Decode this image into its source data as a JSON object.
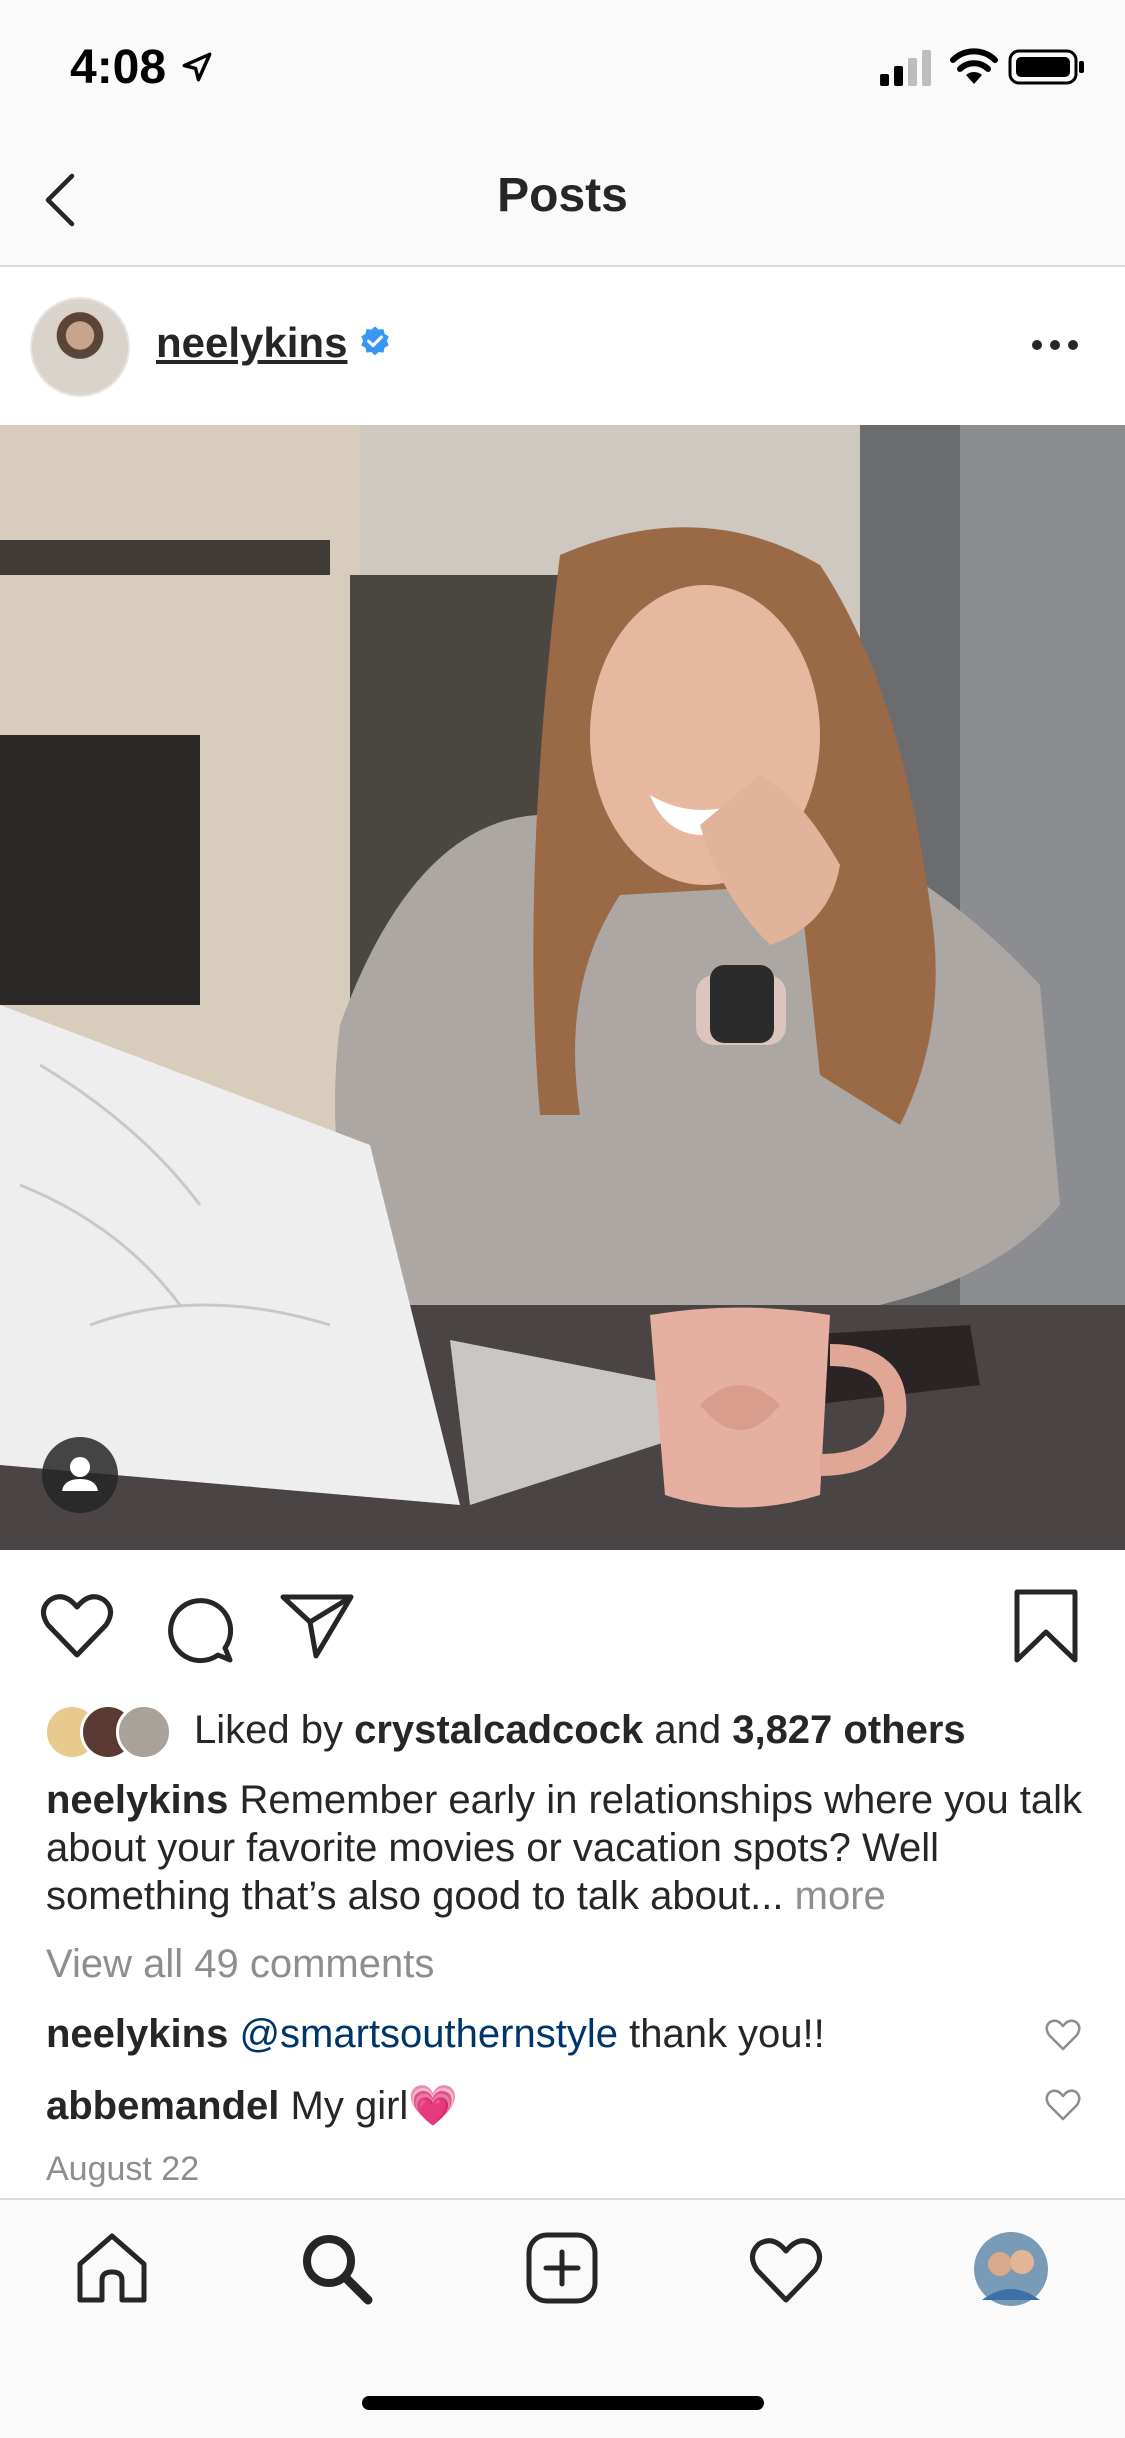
{
  "status_bar": {
    "time": "4:08"
  },
  "header": {
    "title": "Posts"
  },
  "post": {
    "username": "neelykins",
    "likes": {
      "prefix": "Liked by",
      "user": "crystalcadcock",
      "and": "and",
      "count": "3,827 others"
    },
    "caption": {
      "user": "neelykins",
      "text": "Remember early in relationships where you talk about your favorite movies or vacation spots? Well something that’s also good to talk about...",
      "more": "more"
    },
    "view_all_comments": "View all 49 comments",
    "comments": [
      {
        "user": "neelykins",
        "mention": "@smartsouthernstyle",
        "text": "thank you!!"
      },
      {
        "user": "abbemandel",
        "text": "My girl💗"
      }
    ],
    "date": "August 22"
  },
  "tabs": [
    "home-icon",
    "search-icon",
    "new-post-icon",
    "activity-icon",
    "profile-avatar"
  ]
}
